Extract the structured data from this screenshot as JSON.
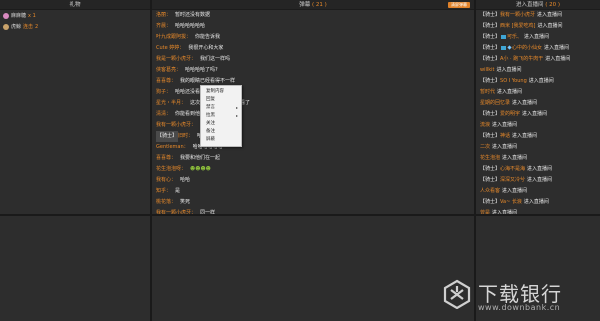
{
  "gifts": {
    "header": "礼物",
    "rows": [
      {
        "user": "麻麻糖",
        "gift": "",
        "qty": "x 1"
      },
      {
        "user": "虎鲸",
        "gift": "连击",
        "qty": "2"
      }
    ]
  },
  "danmu": {
    "header_label": "弹幕",
    "header_count": "( 21 )",
    "clear_label": "清屏弹幕",
    "messages": [
      {
        "user": "洛丽",
        "text": "暂时还没有数据",
        "badge": "",
        "emoji": ""
      },
      {
        "user": "齐晨",
        "text": "哈哈哈哈哈哈",
        "badge": "",
        "emoji": ""
      },
      {
        "user": "叶九成跟阿拔",
        "text": "你能告诉我",
        "badge": "",
        "emoji": ""
      },
      {
        "user": "Cute 婷婷",
        "text": "我很开心和大家",
        "badge": "",
        "emoji": ""
      },
      {
        "user": "我是一颗小虎牙",
        "text": "我们这一样吗",
        "badge": "",
        "emoji": ""
      },
      {
        "user": "侠客葛亮",
        "text": "哈哈哈哈了吗?",
        "badge": "",
        "emoji": ""
      },
      {
        "user": "喜喜尊",
        "text": "我的眼睛已经看得不一样",
        "badge": "",
        "emoji": ""
      },
      {
        "user": "狗子",
        "text": "哈哈还没看不到",
        "badge": "",
        "emoji": ""
      },
      {
        "user": "星光・半月",
        "text": "这次想说的是能不能不看了",
        "badge": "",
        "emoji": ""
      },
      {
        "user": "清清",
        "text": "你能看到他的",
        "badge": "",
        "emoji": ""
      },
      {
        "user": "我有一颗小虎牙",
        "text": "嗯嗯",
        "badge": "",
        "emoji": ""
      },
      {
        "user": "旧时",
        "text": "哈哈我",
        "badge": "【骑士】",
        "emoji": ""
      },
      {
        "user": "Gentleman",
        "text": "哈哈哈哈哈哈",
        "badge": "",
        "emoji": ""
      },
      {
        "user": "喜喜尊",
        "text": "我要和他们在一起",
        "badge": "",
        "emoji": ""
      },
      {
        "user": "花生泡泡呀",
        "text": "",
        "badge": "",
        "emoji": "☻☻☻☻"
      },
      {
        "user": "我有心",
        "text": "哈哈",
        "badge": "",
        "emoji": ""
      },
      {
        "user": "知乎",
        "text": "是",
        "badge": "",
        "emoji": ""
      },
      {
        "user": "桃花落",
        "text": "笑死",
        "badge": "",
        "emoji": ""
      },
      {
        "user": "我有一颗小虎牙",
        "text": "同一样",
        "badge": "",
        "emoji": ""
      },
      {
        "user": "清清",
        "text": "哈哈哈了吗?",
        "badge": "",
        "emoji": ""
      }
    ]
  },
  "context_menu": {
    "items": [
      {
        "label": "复制内容",
        "submenu": false
      },
      {
        "label": "回复",
        "submenu": false
      },
      {
        "label": "禁言",
        "submenu": true
      },
      {
        "label": "拉黑",
        "submenu": true
      },
      {
        "label": "关注",
        "submenu": false
      },
      {
        "label": "备注",
        "submenu": false
      },
      {
        "label": "屏蔽",
        "submenu": false
      }
    ]
  },
  "entries": {
    "header_label": "进入直播间",
    "header_count": "( 20 )",
    "rows": [
      {
        "badge": "【骑士】",
        "user": "我有一颗小虎牙",
        "text": "进入直播间",
        "icons": 0
      },
      {
        "badge": "【骑士】",
        "user": "西米 [我爱吃鸡]",
        "text": "进入直播间",
        "icons": 0
      },
      {
        "badge": "【骑士】",
        "user": "可乐、",
        "text": "进入直播间",
        "icons": 1
      },
      {
        "badge": "【骑士】",
        "user": "心中的小仙女",
        "text": "进入直播间",
        "icons": 2
      },
      {
        "badge": "【骑士】",
        "user": "A小 · 跑飞的牛肉干",
        "text": "进入直播间",
        "icons": 0
      },
      {
        "badge": "",
        "user": "willkit",
        "text": "进入直播间",
        "icons": 0
      },
      {
        "badge": "【骑士】",
        "user": "SO I Young",
        "text": "进入直播间",
        "icons": 0
      },
      {
        "badge": "",
        "user": "暂时代",
        "text": "进入直播间",
        "icons": 0
      },
      {
        "badge": "",
        "user": "星期的回忆录",
        "text": "进入直播间",
        "icons": 0
      },
      {
        "badge": "【骑士】",
        "user": "爱的明宇",
        "text": "进入直播间",
        "icons": 0
      },
      {
        "badge": "",
        "user": "流浪",
        "text": "进入直播间",
        "icons": 0
      },
      {
        "badge": "【骑士】",
        "user": "神话",
        "text": "进入直播间",
        "icons": 0
      },
      {
        "badge": "",
        "user": "二次",
        "text": "进入直播间",
        "icons": 0
      },
      {
        "badge": "",
        "user": "花生泡泡",
        "text": "进入直播间",
        "icons": 0
      },
      {
        "badge": "【骑士】",
        "user": "心海不是海",
        "text": "进入直播间",
        "icons": 0
      },
      {
        "badge": "【骑士】",
        "user": "深深又冷兮",
        "text": "进入直播间",
        "icons": 0
      },
      {
        "badge": "",
        "user": "人众看客",
        "text": "进入直播间",
        "icons": 0
      },
      {
        "badge": "【骑士】",
        "user": "Va~ 长浪",
        "text": "进入直播间",
        "icons": 0
      },
      {
        "badge": "",
        "user": "曾是",
        "text": "进入直播间",
        "icons": 0
      },
      {
        "badge": "【骑士】",
        "user": "小卡爱",
        "text": "进入直播间",
        "icons": 0
      }
    ]
  },
  "watermark": {
    "title": "下载银行",
    "url": "www.downbank.cn"
  }
}
